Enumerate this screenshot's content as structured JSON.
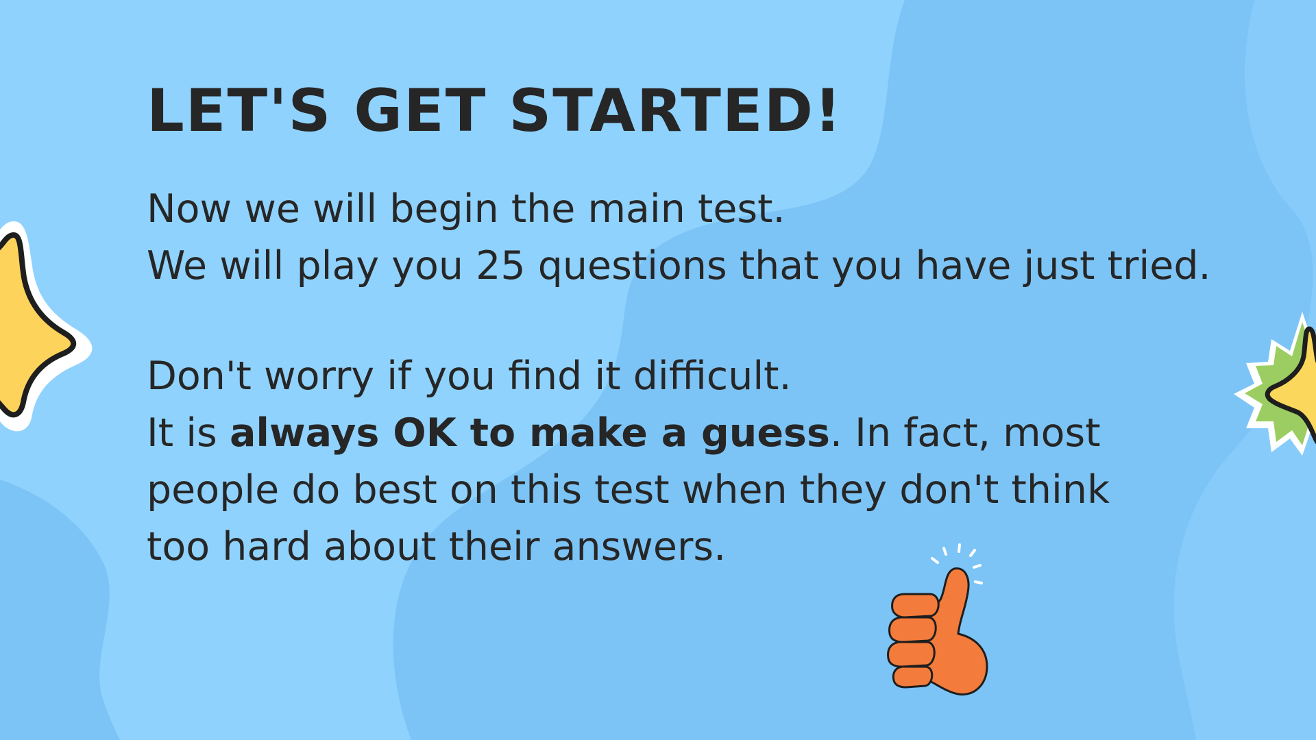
{
  "slide": {
    "title": "LET'S GET STARTED!",
    "paragraph_1": {
      "line_1": "Now we will begin the main test.",
      "line_2": "We will play you 25 questions that you have just tried."
    },
    "paragraph_2": {
      "line_1": "Don't worry if you find it difficult.",
      "line_2_prefix": "It is ",
      "line_2_bold": "always OK to make a guess",
      "line_2_suffix": ". In fact, most",
      "line_3": "people do best on this test when they don't think",
      "line_4": "too hard about their answers."
    }
  },
  "decorations": {
    "star_left_icon": "star-icon",
    "badge_right_icon": "star-badge-icon",
    "thumbs_icon": "thumbs-up-icon"
  },
  "colors": {
    "background": "#8fd2fd",
    "background_blob": "#7cc4f6",
    "text": "#262626",
    "star_yellow": "#fdd35b",
    "badge_green": "#9ccd62",
    "thumb_orange": "#f37b3c"
  }
}
